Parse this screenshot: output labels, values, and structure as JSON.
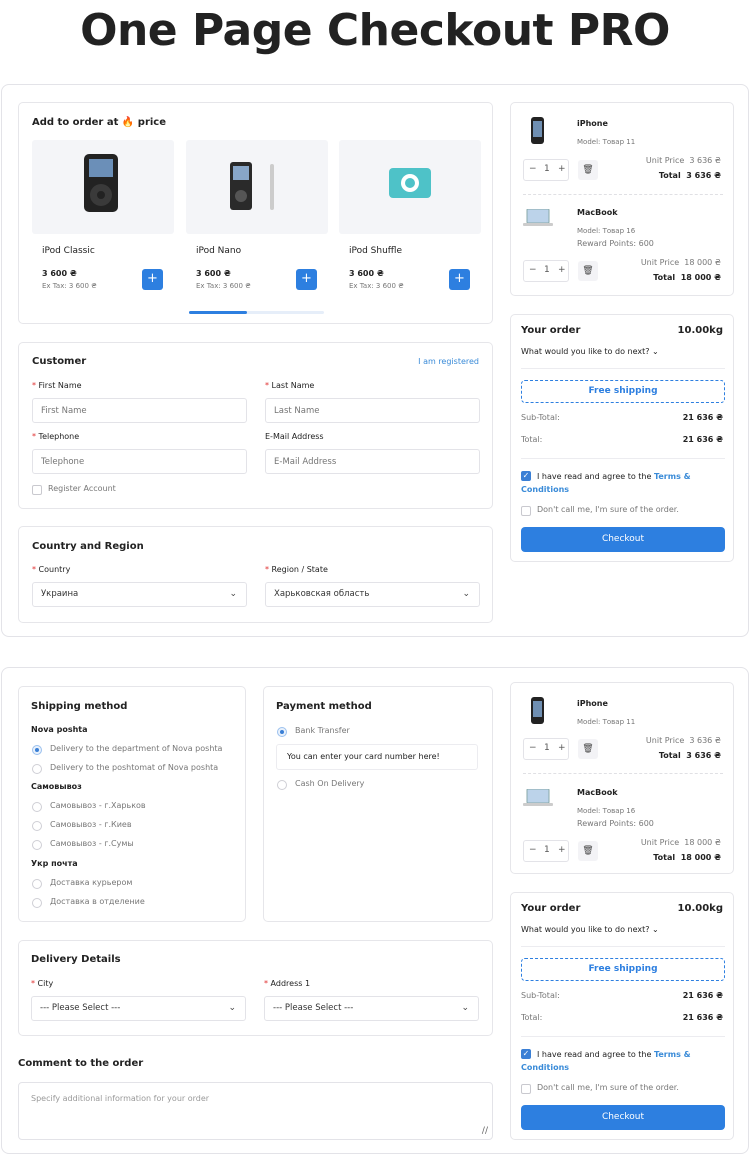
{
  "title": "One Page Checkout PRO",
  "colors": {
    "accent": "#2d7fe0",
    "required": "#e03030",
    "link": "#3a8bd8"
  },
  "upsell": {
    "title_prefix": "Add to order at",
    "title_suffix": "price",
    "title_icon": "fire-icon",
    "products": [
      {
        "name": "iPod Classic",
        "price": "3 600 ₴",
        "extax": "Ex Tax: 3 600 ₴",
        "add": "+"
      },
      {
        "name": "iPod Nano",
        "price": "3 600 ₴",
        "extax": "Ex Tax: 3 600 ₴",
        "add": "+"
      },
      {
        "name": "iPod Shuffle",
        "price": "3 600 ₴",
        "extax": "Ex Tax: 3 600 ₴",
        "add": "+"
      }
    ],
    "carousel_position": 0.43
  },
  "customer": {
    "title": "Customer",
    "registered_link": "I am registered",
    "first_name": {
      "label": "First Name",
      "placeholder": "First Name"
    },
    "last_name": {
      "label": "Last Name",
      "placeholder": "Last Name"
    },
    "telephone": {
      "label": "Telephone",
      "placeholder": "Telephone"
    },
    "email": {
      "label": "E-Mail Address",
      "placeholder": "E-Mail Address"
    },
    "register_label": "Register Account",
    "required_mark": "*"
  },
  "country_region": {
    "title": "Country and Region",
    "country_label": "Country",
    "country_value": "Украина",
    "region_label": "Region / State",
    "region_value": "Харьковская область"
  },
  "cart": {
    "items": [
      {
        "name": "iPhone",
        "model": "Model: Товар 11",
        "reward": "",
        "qty": "1",
        "unit_label": "Unit Price",
        "unit_price": "3 636 ₴",
        "total_label": "Total",
        "total": "3 636 ₴"
      },
      {
        "name": "MacBook",
        "model": "Model: Товар 16",
        "reward": "Reward Points: 600",
        "qty": "1",
        "unit_label": "Unit Price",
        "unit_price": "18 000 ₴",
        "total_label": "Total",
        "total": "18 000 ₴"
      }
    ],
    "minus": "−",
    "plus": "+"
  },
  "order": {
    "title": "Your order",
    "weight": "10.00kg",
    "next_label": "What would you like to do next?",
    "free_shipping": "Free shipping",
    "subtotal_label": "Sub-Total:",
    "subtotal": "21 636 ₴",
    "total_label": "Total:",
    "total": "21 636 ₴",
    "agree_prefix": "I have read and agree to the",
    "agree_link": "Terms & Conditions",
    "dont_call": "Don't call me, I'm sure of the order.",
    "checkout": "Checkout"
  },
  "shipping": {
    "title": "Shipping method",
    "groups": [
      {
        "name": "Nova poshta",
        "options": [
          "Delivery to the department of Nova poshta",
          "Delivery to the poshtomat of Nova poshta"
        ]
      },
      {
        "name": "Самовывоз",
        "options": [
          "Самовывоз - г.Харьков",
          "Самовывоз - г.Киев",
          "Самовывоз - г.Сумы"
        ]
      },
      {
        "name": "Укр почта",
        "options": [
          "Доставка курьером",
          "Доставка в отделение"
        ]
      }
    ]
  },
  "payment": {
    "title": "Payment method",
    "bank": "Bank Transfer",
    "bank_note": "You can enter your card number here!",
    "cod": "Cash On Delivery"
  },
  "delivery": {
    "title": "Delivery Details",
    "city_label": "City",
    "city_value": "--- Please Select ---",
    "address_label": "Address 1",
    "address_value": "--- Please Select ---"
  },
  "comment": {
    "title": "Comment to the order",
    "placeholder": "Specify additional information for your order"
  }
}
